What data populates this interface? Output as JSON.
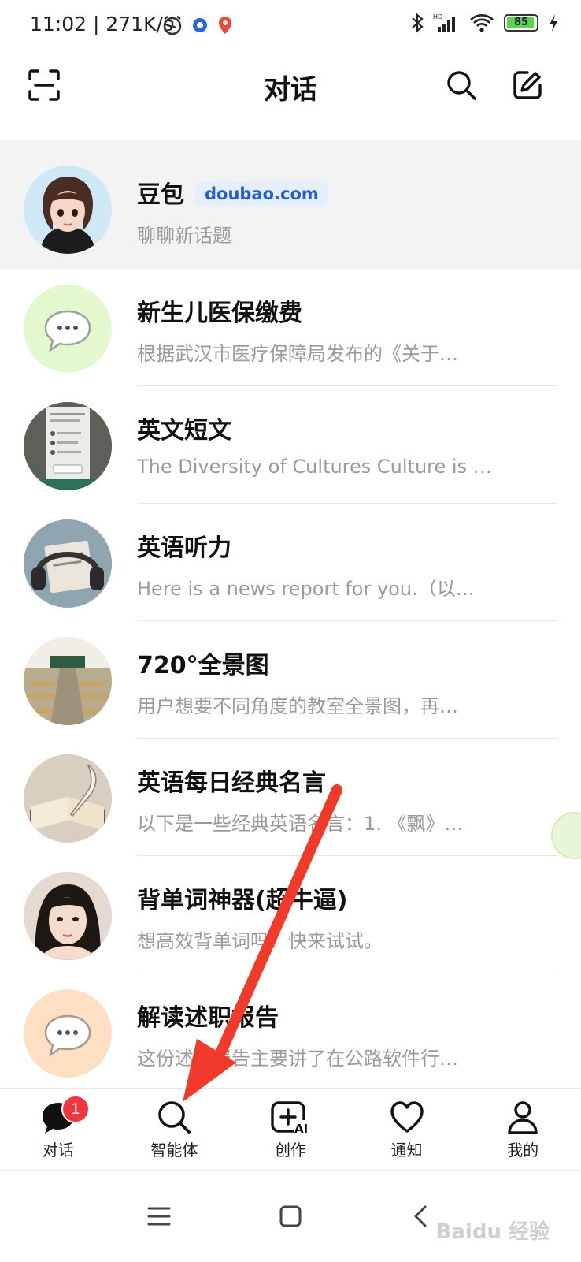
{
  "status_bar": {
    "time": "11:02 | 271K/s",
    "battery_level": "85"
  },
  "header": {
    "title": "对话"
  },
  "conversations": [
    {
      "title": "豆包",
      "tag": "doubao.com",
      "preview": "聊聊新话题",
      "avatar_icon": "doubao-girl-avatar",
      "pinned": true
    },
    {
      "title": "新生儿医保缴费",
      "preview": "根据武汉市医疗保障局发布的《关于…",
      "avatar_icon": "chat-bubble-icon",
      "avatar_color": "#e3f8cf"
    },
    {
      "title": "英文短文",
      "preview": "The Diversity of Cultures Culture is …",
      "avatar_icon": "document-photo-avatar"
    },
    {
      "title": "英语听力",
      "preview": "Here is a news report for you.（以…",
      "avatar_icon": "headphones-photo-avatar"
    },
    {
      "title": "720°全景图",
      "preview": "用户想要不同角度的教室全景图，再…",
      "avatar_icon": "classroom-photo-avatar"
    },
    {
      "title": "英语每日经典名言",
      "preview": "以下是一些经典英语名言：1. 《飘》…",
      "avatar_icon": "book-quill-avatar"
    },
    {
      "title": "背单词神器(超牛逼)",
      "preview": "想高效背单词吗？快来试试。",
      "avatar_icon": "girl-portrait-avatar"
    },
    {
      "title": "解读述职报告",
      "preview": "这份述职报告主要讲了在公路软件行…",
      "avatar_icon": "chat-bubble-icon",
      "avatar_color": "#fde0c4"
    }
  ],
  "tabs": [
    {
      "label": "对话",
      "icon": "chat-icon",
      "badge": "1"
    },
    {
      "label": "智能体",
      "icon": "search-icon"
    },
    {
      "label": "创作",
      "icon": "create-ai-icon"
    },
    {
      "label": "通知",
      "icon": "heart-icon"
    },
    {
      "label": "我的",
      "icon": "person-icon"
    }
  ],
  "watermark": "Baidu 经验",
  "colors": {
    "accent_arrow": "#f23a2a",
    "tag_blue": "#1f5fd6",
    "badge_red": "#f0353b"
  }
}
